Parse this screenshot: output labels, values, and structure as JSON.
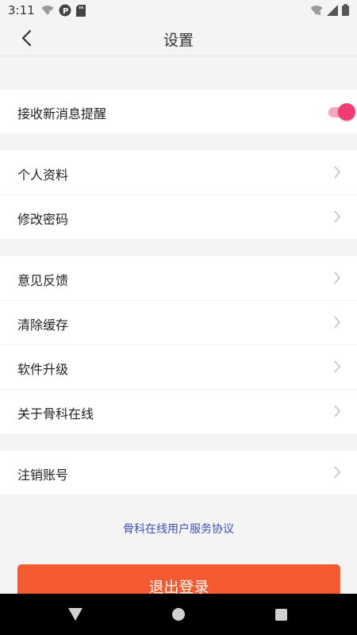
{
  "status_bar": {
    "time": "3:11"
  },
  "header": {
    "title": "设置"
  },
  "settings": {
    "notify_label": "接收新消息提醒",
    "notify_enabled": true,
    "profile_label": "个人资料",
    "password_label": "修改密码",
    "feedback_label": "意见反馈",
    "clear_cache_label": "清除缓存",
    "upgrade_label": "软件升级",
    "about_label": "关于骨科在线",
    "deactivate_label": "注销账号"
  },
  "agreement_link": "骨科在线用户服务协议",
  "logout_button": "退出登录",
  "colors": {
    "accent": "#f23b74",
    "logout": "#f45a2f",
    "link": "#3d4fb3"
  }
}
